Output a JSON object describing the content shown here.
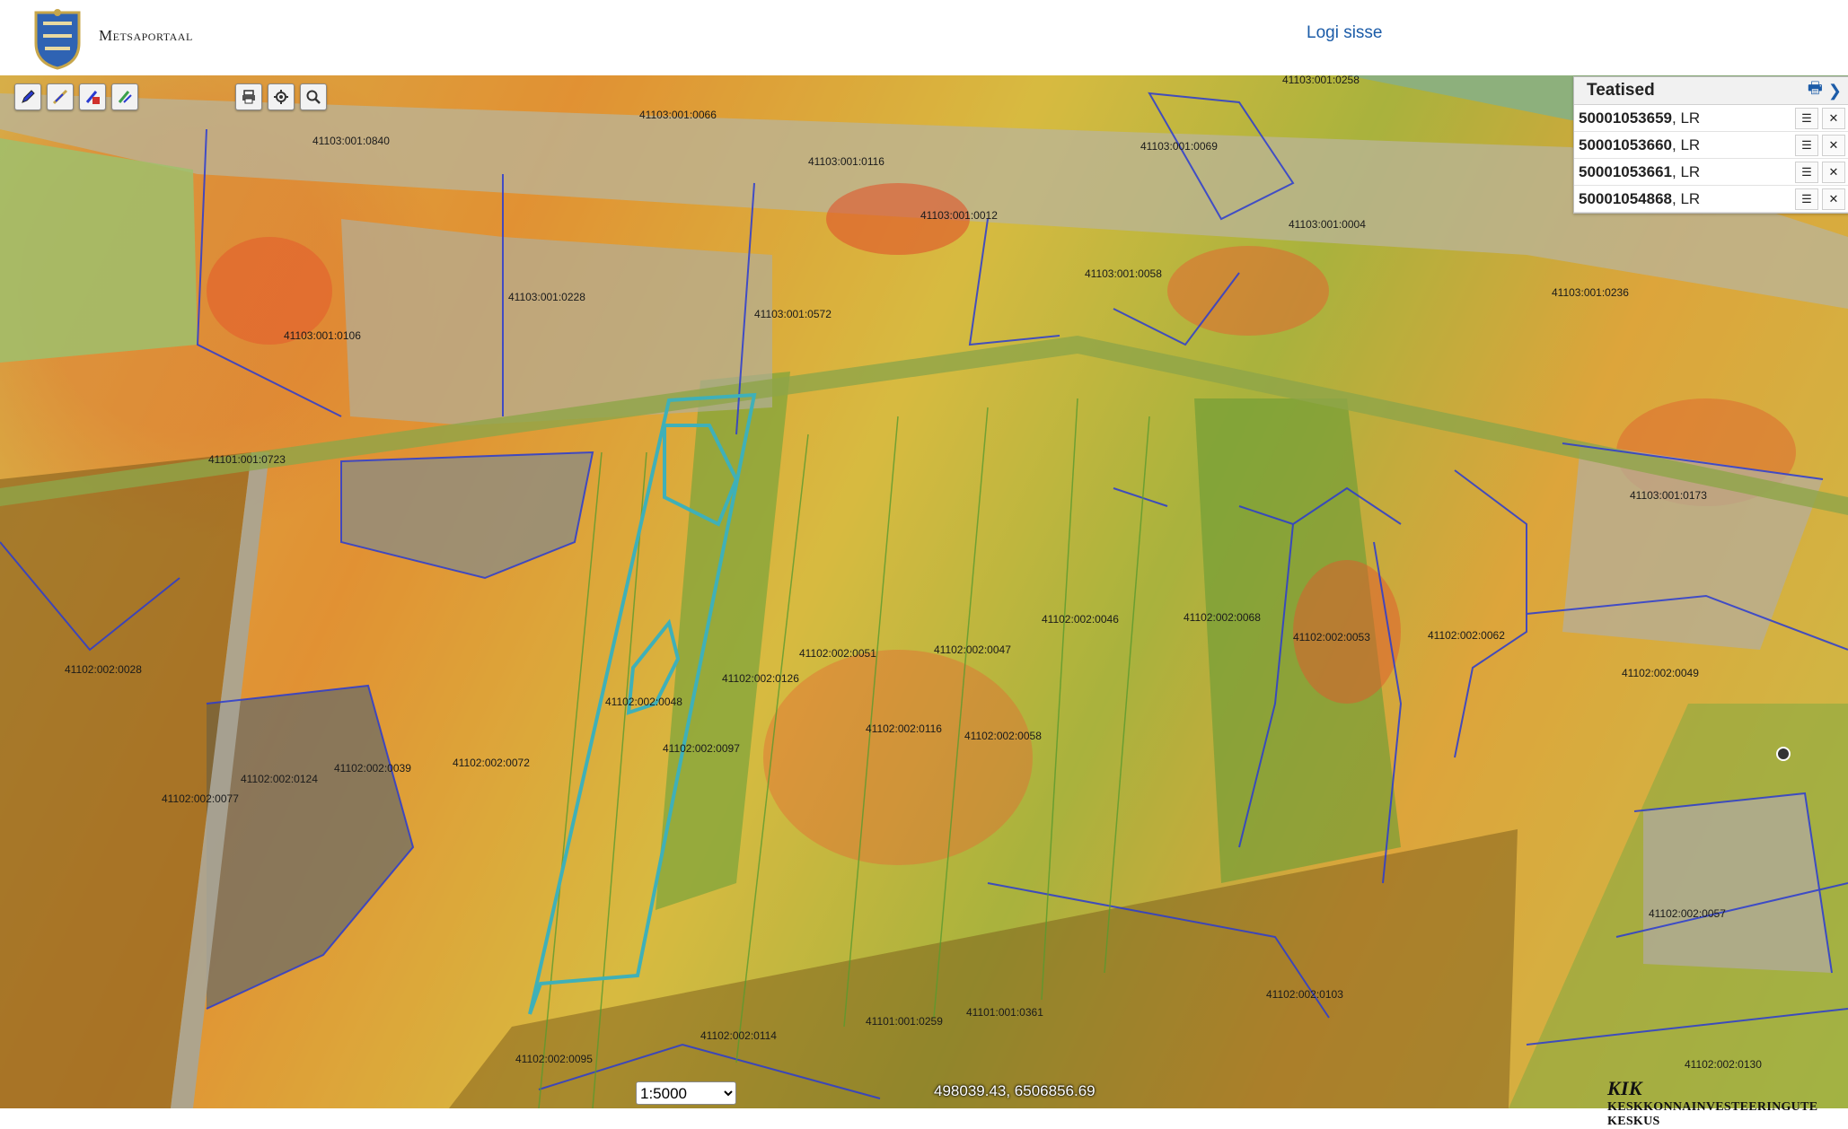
{
  "header": {
    "brand": "Metsaportaal",
    "login_label": "Logi sisse"
  },
  "toolbar": {
    "draw_tools": [
      "pencil-icon",
      "pencil-line-icon",
      "pencil-delete-icon",
      "pencil-green-icon"
    ],
    "map_tools": [
      "print-icon",
      "locate-icon",
      "search-icon"
    ]
  },
  "panel": {
    "title": "Teatised",
    "items": [
      {
        "id": "50001053659",
        "suffix": ", LR"
      },
      {
        "id": "50001053660",
        "suffix": ", LR"
      },
      {
        "id": "50001053661",
        "suffix": ", LR"
      },
      {
        "id": "50001054868",
        "suffix": ", LR"
      }
    ]
  },
  "map": {
    "scale": "1:5000",
    "scale_options": [
      "1:5000"
    ],
    "coordinates": "498039.43, 6506856.69",
    "credit": "Keskkonnainvesteeringute Keskus",
    "credit_mark": "KIK",
    "parcel_labels": [
      "41103:001:0066",
      "41103:001:0840",
      "41103:001:0116",
      "41103:001:0069",
      "41103:001:0012",
      "41103:001:0004",
      "41103:001:0058",
      "41103:001:0236",
      "41103:001:0228",
      "41103:001:0572",
      "41103:001:0106",
      "41101:001:0723",
      "41103:001:0173",
      "41102:002:0028",
      "41102:002:0046",
      "41102:002:0068",
      "41102:002:0053",
      "41102:002:0062",
      "41102:002:0049",
      "41102:002:0051",
      "41102:002:0047",
      "41102:002:0126",
      "41102:002:0048",
      "41102:002:0097",
      "41102:002:0116",
      "41102:002:0058",
      "41102:002:0072",
      "41102:002:0124",
      "41102:002:0039",
      "41102:002:0077",
      "41102:002:0057",
      "41102:002:0103",
      "41101:001:0259",
      "41101:001:0361",
      "41102:002:0114",
      "41102:002:0095",
      "41102:002:0130",
      "41103:001:0258"
    ]
  },
  "colors": {
    "link": "#1c5ca8",
    "parcel_boundary": "#2a3bd1",
    "selected_boundary": "#3fb0b8",
    "restricted_zone": "#7a5a1a"
  }
}
